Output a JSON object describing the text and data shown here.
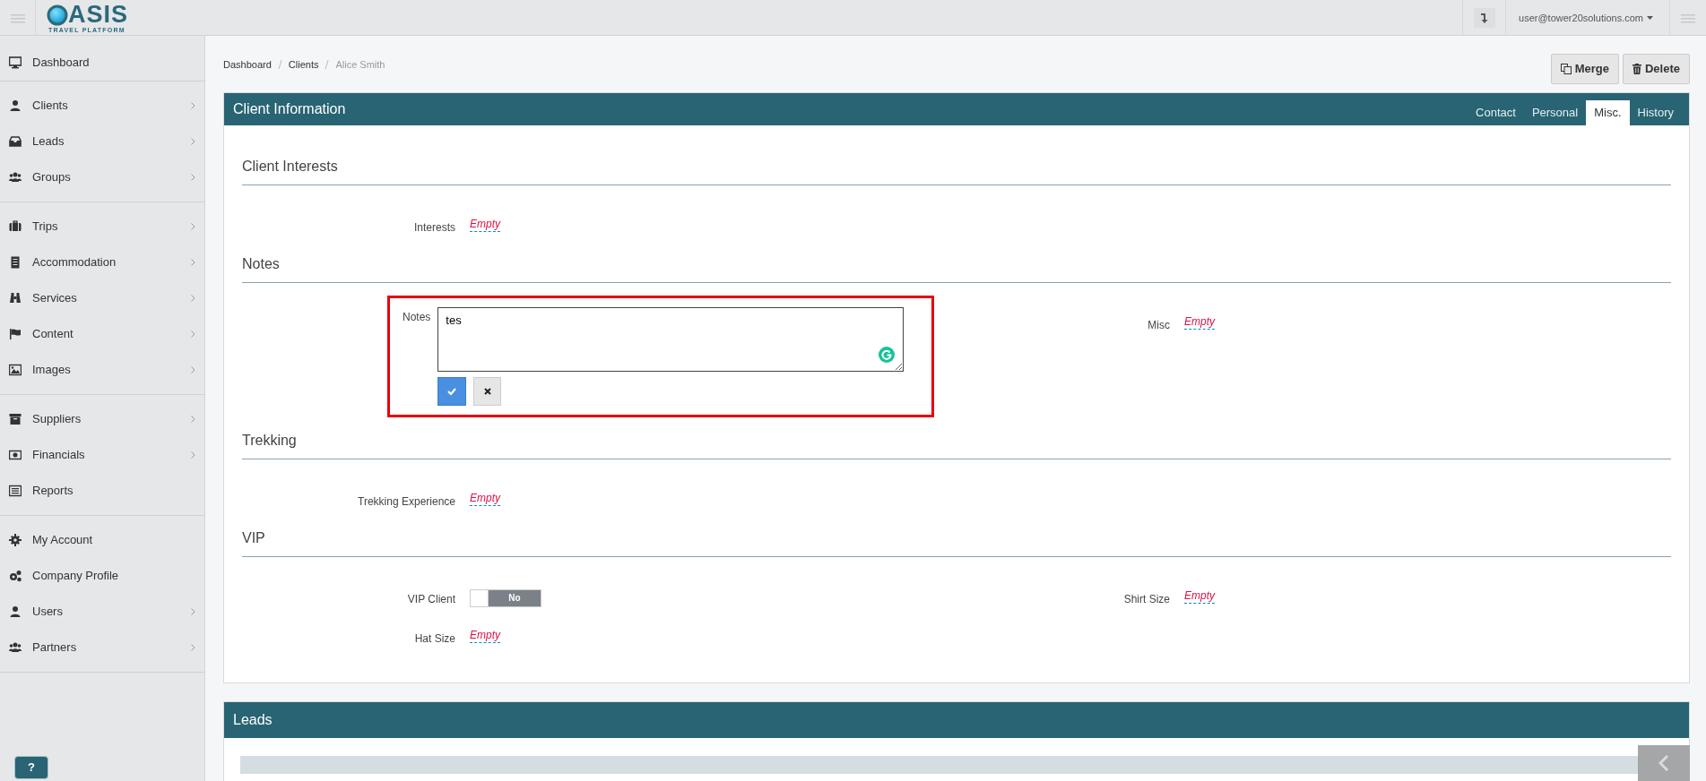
{
  "topbar": {
    "logo": "ASIS",
    "logo_subtitle": "TRAVEL PLATFORM",
    "user": "user@tower20solutions.com"
  },
  "sidebar": {
    "groups": [
      [
        {
          "label": "Dashboard",
          "has_children": false
        }
      ],
      [
        {
          "label": "Clients",
          "has_children": true
        },
        {
          "label": "Leads",
          "has_children": true
        },
        {
          "label": "Groups",
          "has_children": true
        }
      ],
      [
        {
          "label": "Trips",
          "has_children": true
        },
        {
          "label": "Accommodation",
          "has_children": true
        },
        {
          "label": "Services",
          "has_children": true
        },
        {
          "label": "Content",
          "has_children": true
        },
        {
          "label": "Images",
          "has_children": true
        }
      ],
      [
        {
          "label": "Suppliers",
          "has_children": true
        },
        {
          "label": "Financials",
          "has_children": true
        },
        {
          "label": "Reports",
          "has_children": false
        }
      ],
      [
        {
          "label": "My Account",
          "has_children": false
        },
        {
          "label": "Company Profile",
          "has_children": false
        },
        {
          "label": "Users",
          "has_children": true
        },
        {
          "label": "Partners",
          "has_children": true
        }
      ]
    ],
    "help_button": "?"
  },
  "breadcrumb": [
    {
      "label": "Dashboard",
      "current": false
    },
    {
      "label": "Clients",
      "current": false
    },
    {
      "label": "Alice Smith",
      "current": true
    }
  ],
  "actions": [
    {
      "kind": "merge",
      "label": "Merge"
    },
    {
      "kind": "delete",
      "label": "Delete"
    }
  ],
  "panel": {
    "title": "Client Information",
    "tabs": [
      {
        "label": "Contact",
        "selected": false
      },
      {
        "label": "Personal",
        "selected": false
      },
      {
        "label": "Misc.",
        "selected": true
      },
      {
        "label": "History",
        "selected": false
      }
    ],
    "sections": [
      {
        "title": "Client Interests",
        "rows": [
          [
            {
              "kind": "editable",
              "label": "Interests",
              "value": "Empty"
            }
          ]
        ]
      },
      {
        "title": "Notes",
        "rows": [
          [
            {
              "kind": "editor",
              "label": "Notes",
              "value": "tes",
              "highlighted": true
            },
            {
              "kind": "editable",
              "label": "Misc",
              "value": "Empty"
            }
          ]
        ]
      },
      {
        "title": "Trekking",
        "rows": [
          [
            {
              "kind": "editable",
              "label": "Trekking Experience",
              "value": "Empty"
            }
          ]
        ]
      },
      {
        "title": "VIP",
        "rows": [
          [
            {
              "kind": "toggle",
              "label": "VIP Client",
              "on": false,
              "text": "No"
            },
            {
              "kind": "editable",
              "label": "Shirt Size",
              "value": "Empty"
            }
          ],
          [
            {
              "kind": "editable",
              "label": "Hat Size",
              "value": "Empty"
            }
          ]
        ]
      }
    ]
  },
  "leads_panel": {
    "title": "Leads"
  }
}
